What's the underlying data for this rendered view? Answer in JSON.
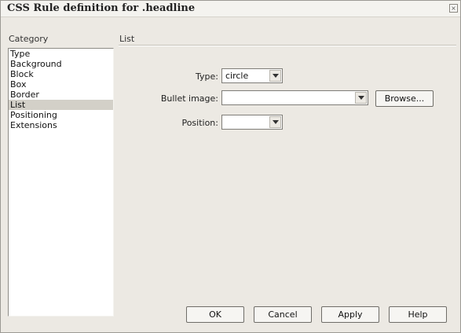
{
  "window": {
    "title": "CSS Rule definition for .headline",
    "close_glyph": "×"
  },
  "category": {
    "heading": "Category",
    "items": [
      "Type",
      "Background",
      "Block",
      "Box",
      "Border",
      "List",
      "Positioning",
      "Extensions"
    ],
    "selected": "List"
  },
  "panel": {
    "heading": "List",
    "type_label": "Type:",
    "type_value": "circle",
    "bullet_label": "Bullet image:",
    "bullet_value": "",
    "browse_label": "Browse...",
    "position_label": "Position:",
    "position_value": ""
  },
  "buttons": {
    "ok": "OK",
    "cancel": "Cancel",
    "apply": "Apply",
    "help": "Help"
  },
  "icons": {
    "dropdown": "chevron-down-icon",
    "close": "close-icon"
  }
}
